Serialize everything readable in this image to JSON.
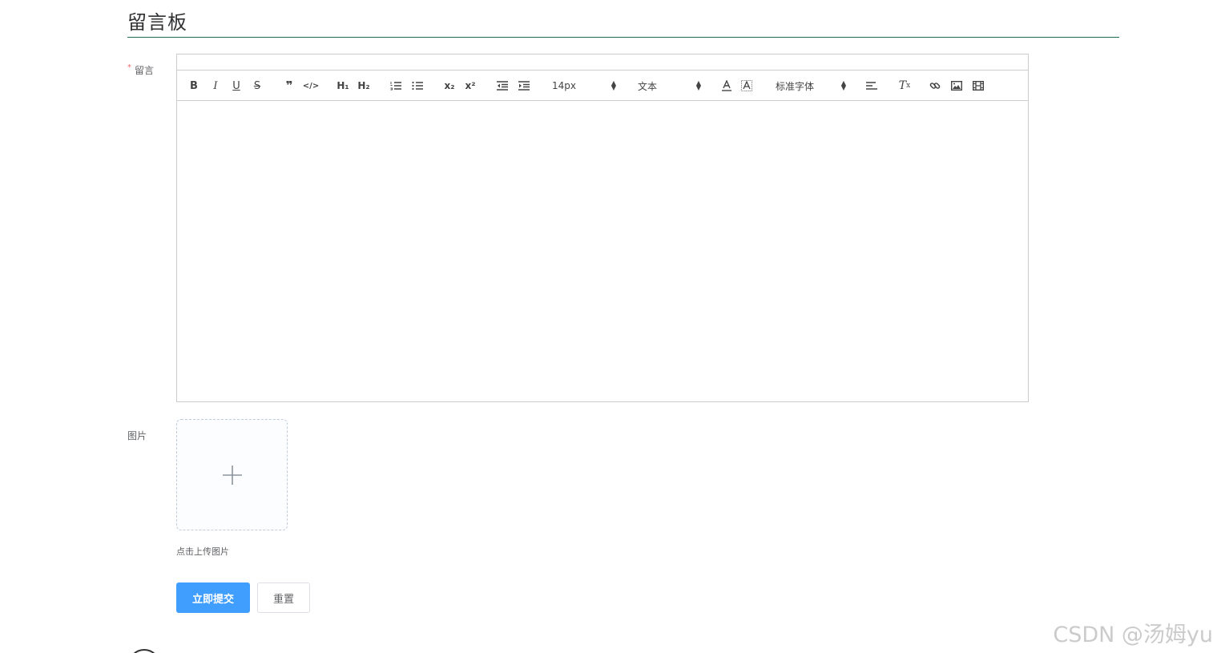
{
  "page": {
    "title": "留言板"
  },
  "form": {
    "message_label": "留言",
    "required_mark": "*",
    "image_label": "图片",
    "upload_hint": "点击上传图片",
    "submit_label": "立即提交",
    "reset_label": "重置"
  },
  "editor": {
    "toolbar": {
      "size_value": "14px",
      "header_value": "文本",
      "font_value": "标准字体",
      "icons": [
        "bold-icon",
        "italic-icon",
        "underline-icon",
        "strike-icon",
        "blockquote-icon",
        "code-block-icon",
        "h1-icon",
        "h2-icon",
        "ordered-list-icon",
        "bullet-list-icon",
        "subscript-icon",
        "superscript-icon",
        "outdent-icon",
        "indent-icon",
        "font-color-icon",
        "background-color-icon",
        "align-icon",
        "clear-format-icon",
        "link-icon",
        "image-icon",
        "video-icon"
      ]
    },
    "content": ""
  },
  "watermark": "CSDN @汤姆yu",
  "colors": {
    "primary": "#409eff",
    "title_rule": "#1f6b4f",
    "required": "#f56c6c"
  }
}
